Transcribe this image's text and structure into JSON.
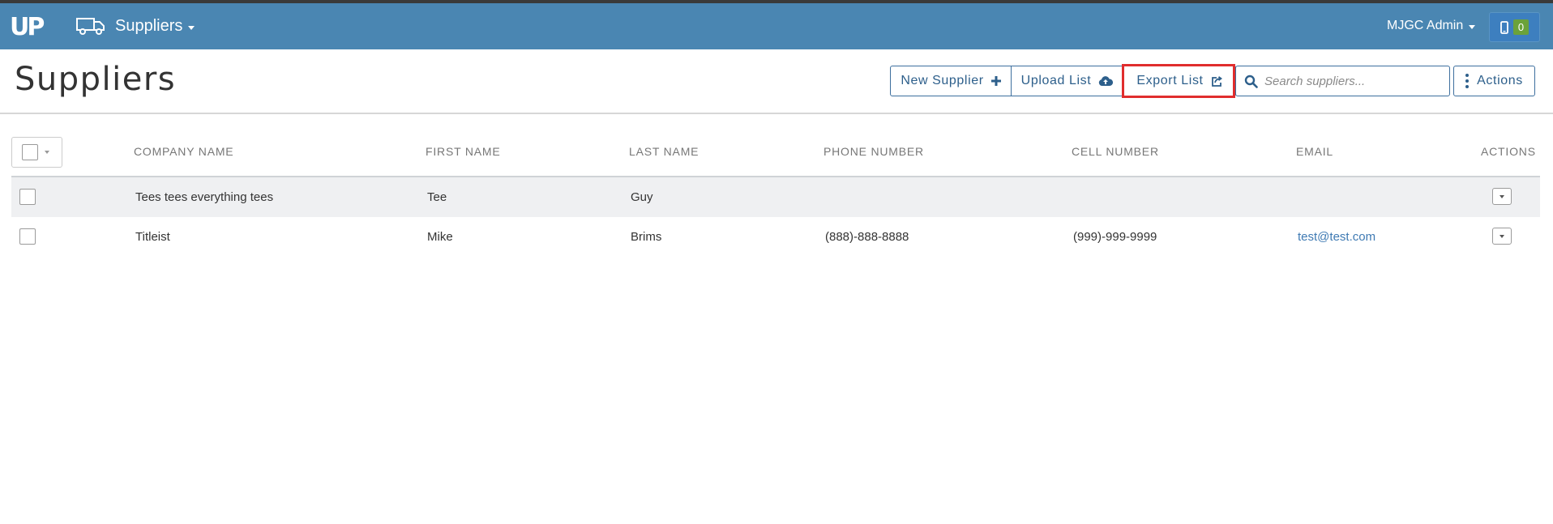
{
  "navbar": {
    "logo_text": "UP",
    "module_title": "Suppliers",
    "user_name": "MJGC Admin",
    "device_count": "0"
  },
  "page": {
    "title": "Suppliers"
  },
  "toolbar": {
    "new_supplier_label": "New Supplier",
    "upload_list_label": "Upload List",
    "export_list_label": "Export List",
    "search_placeholder": "Search suppliers...",
    "actions_label": "Actions"
  },
  "table": {
    "columns": [
      "COMPANY NAME",
      "FIRST NAME",
      "LAST NAME",
      "PHONE NUMBER",
      "CELL NUMBER",
      "EMAIL",
      "ACTIONS"
    ],
    "rows": [
      {
        "company": "Tees tees everything tees",
        "first": "Tee",
        "last": "Guy",
        "phone": "",
        "cell": "",
        "email": ""
      },
      {
        "company": "Titleist",
        "first": "Mike",
        "last": "Brims",
        "phone": "(888)-888-8888",
        "cell": "(999)-999-9999",
        "email": "test@test.com"
      }
    ]
  },
  "colors": {
    "navbar": "#4a86b2",
    "accent": "#2d5f8b",
    "highlight": "#e02d2d",
    "badge": "#6ba23a"
  }
}
